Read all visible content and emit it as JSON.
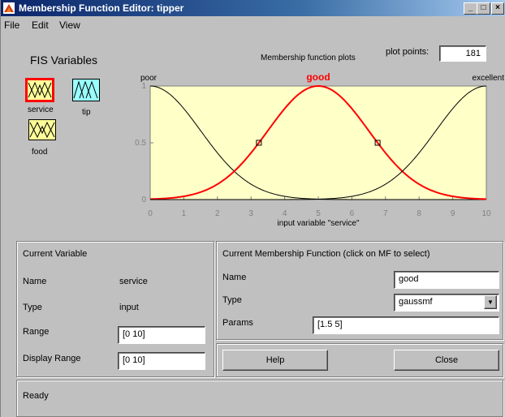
{
  "window": {
    "title": "Membership Function Editor: tipper"
  },
  "menu": {
    "items": [
      "File",
      "Edit",
      "View"
    ]
  },
  "fis": {
    "heading": "FIS Variables",
    "variables": [
      {
        "name": "service",
        "kind": "input",
        "color": "#ffff99",
        "selected": true
      },
      {
        "name": "tip",
        "kind": "output",
        "color": "#99ffff",
        "selected": false
      },
      {
        "name": "food",
        "kind": "input",
        "color": "#ffff99",
        "selected": false
      }
    ]
  },
  "plot": {
    "caption": "Membership function plots",
    "points_label": "plot points:",
    "points_value": "181"
  },
  "chart_data": {
    "type": "line",
    "xlabel": "input variable \"service\"",
    "xlim": [
      0,
      10
    ],
    "ylim": [
      0,
      1
    ],
    "x_ticks": [
      "0",
      "1",
      "2",
      "3",
      "4",
      "5",
      "6",
      "7",
      "8",
      "9",
      "10"
    ],
    "y_ticks": [
      "0",
      "0.5",
      "1"
    ],
    "background": "#ffffc8",
    "series": [
      {
        "name": "poor",
        "function": "gaussmf",
        "sigma": 1.5,
        "center": 0,
        "color": "#000000",
        "selected": false
      },
      {
        "name": "good",
        "function": "gaussmf",
        "sigma": 1.5,
        "center": 5,
        "color": "#ff0000",
        "selected": true
      },
      {
        "name": "excellent",
        "function": "gaussmf",
        "sigma": 1.5,
        "center": 10,
        "color": "#000000",
        "selected": false
      }
    ]
  },
  "current_variable": {
    "heading": "Current Variable",
    "name_label": "Name",
    "name_value": "service",
    "type_label": "Type",
    "type_value": "input",
    "range_label": "Range",
    "range_value": "[0 10]",
    "display_range_label": "Display Range",
    "display_range_value": "[0 10]"
  },
  "current_mf": {
    "heading": "Current Membership Function (click on MF to select)",
    "name_label": "Name",
    "name_value": "good",
    "type_label": "Type",
    "type_value": "gaussmf",
    "params_label": "Params",
    "params_value": "[1.5 5]"
  },
  "buttons": {
    "help": "Help",
    "close": "Close"
  },
  "status": "Ready"
}
